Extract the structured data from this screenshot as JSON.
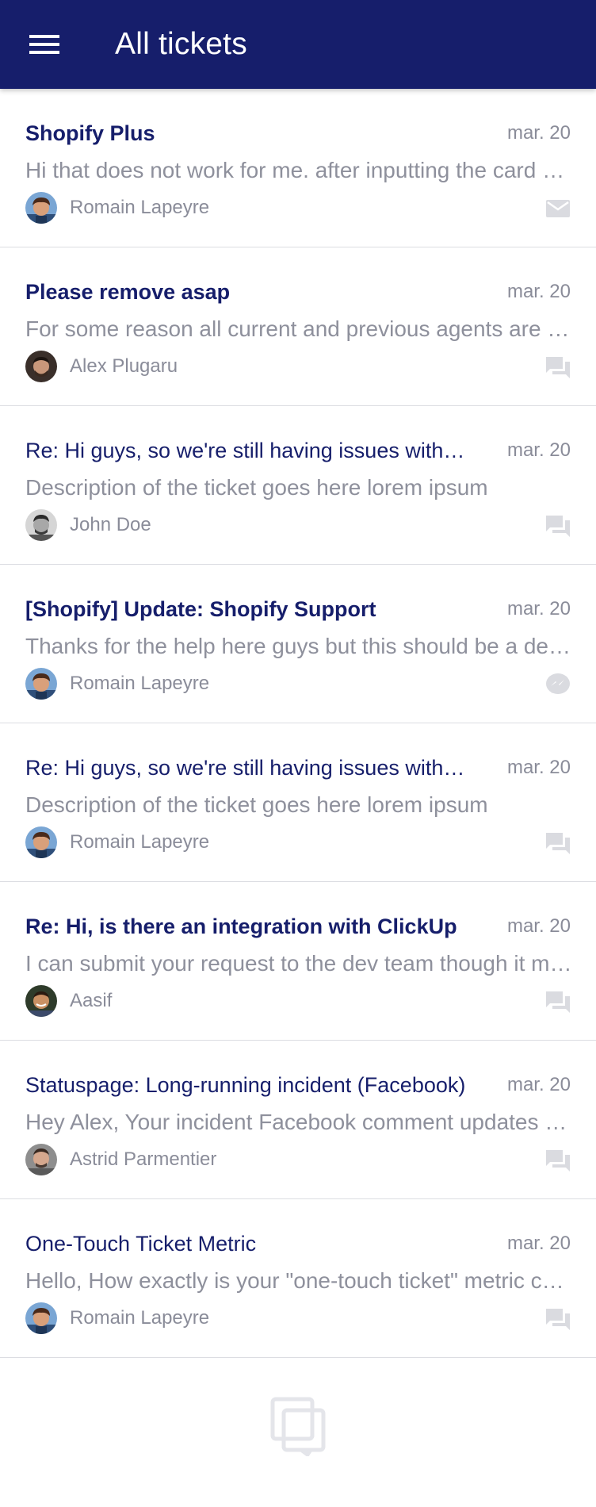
{
  "header": {
    "title": "All tickets",
    "menu_icon": "hamburger-menu-icon",
    "background": "#161e6b"
  },
  "tickets": [
    {
      "subject": "Shopify Plus",
      "unread": true,
      "date": "mar. 20",
      "preview": "Hi that does not work for me. after inputting the card details and clicking on start trial, it redirects",
      "requester": "Romain Lapeyre",
      "avatar": "romain",
      "channel": "email"
    },
    {
      "subject": "Please remove asap",
      "unread": true,
      "date": "mar. 20",
      "preview": "For some reason all current and previous agents are showing up on the list",
      "requester": "Alex Plugaru",
      "avatar": "alex",
      "channel": "chat"
    },
    {
      "subject": "Re: Hi guys, so we're still having issues with the integration",
      "unread": false,
      "date": "mar. 20",
      "preview": "Description of the ticket goes here lorem ipsum",
      "requester": "John Doe",
      "avatar": "john",
      "channel": "chat"
    },
    {
      "subject": "[Shopify] Update: Shopify Support",
      "unread": true,
      "date": "mar. 20",
      "preview": "Thanks for the help here guys but this should be a default setting",
      "requester": "Romain Lapeyre",
      "avatar": "romain",
      "channel": "messenger"
    },
    {
      "subject": "Re: Hi guys, so we're still having issues with the integration",
      "unread": false,
      "date": "mar. 20",
      "preview": "Description of the ticket goes here lorem ipsum",
      "requester": "Romain Lapeyre",
      "avatar": "romain",
      "channel": "chat"
    },
    {
      "subject": "Re: Hi, is there an integration with ClickUp",
      "unread": true,
      "date": "mar. 20",
      "preview": "I can submit your request to the dev team though it may take a while",
      "requester": "Aasif",
      "avatar": "aasif",
      "channel": "chat"
    },
    {
      "subject": "Statuspage: Long-running incident (Facebook)",
      "unread": false,
      "date": "mar. 20",
      "preview": "Hey Alex, Your incident Facebook comment updates are delayed",
      "requester": "Astrid Parmentier",
      "avatar": "astrid",
      "channel": "chat"
    },
    {
      "subject": "One-Touch Ticket Metric",
      "unread": false,
      "date": "mar. 20",
      "preview": "Hello, How exactly is your \"one-touch ticket\" metric calculated?",
      "requester": "Romain Lapeyre",
      "avatar": "romain",
      "channel": "chat"
    }
  ],
  "footer": {
    "logo_icon": "gorgias-logo-icon"
  }
}
